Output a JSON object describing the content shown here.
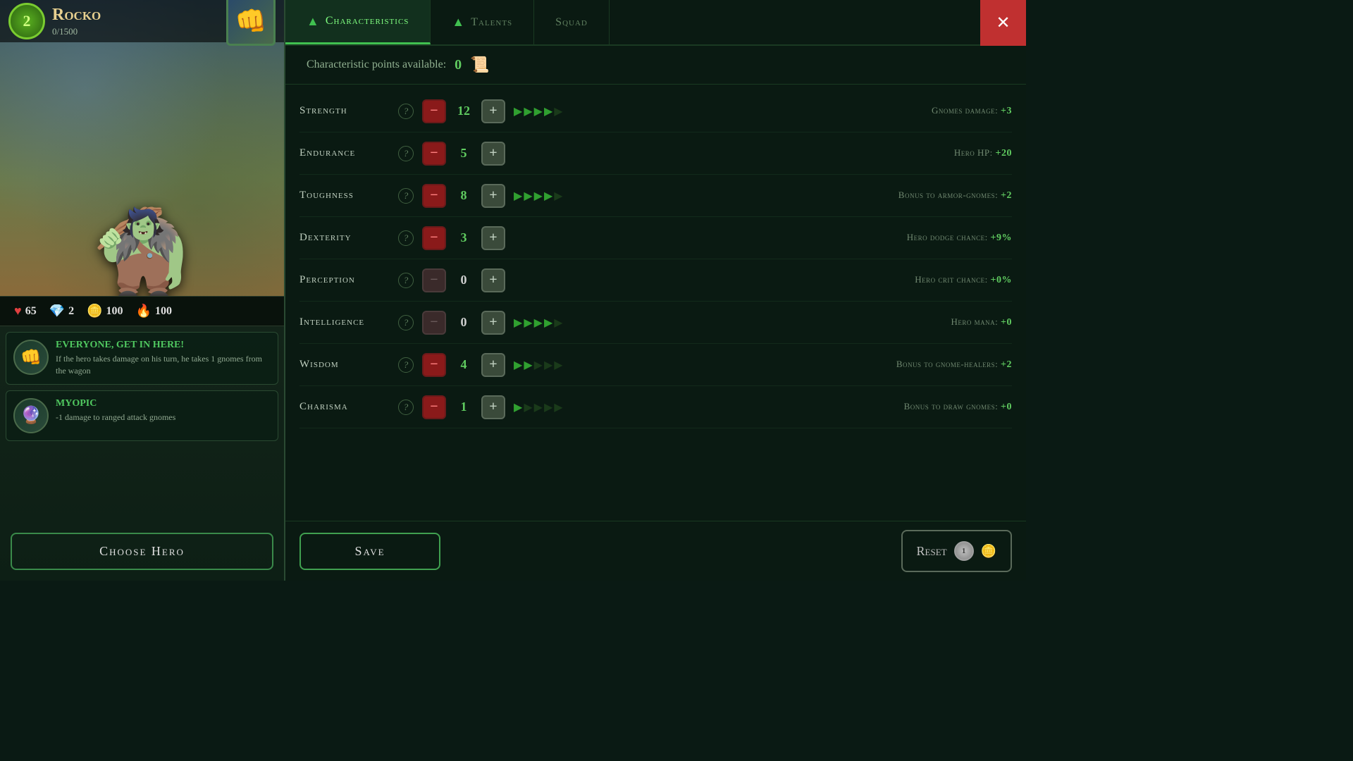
{
  "hero": {
    "name": "Rocko",
    "level": 2,
    "hp_current": 0,
    "hp_max": 1500,
    "stats": {
      "health": 65,
      "gems": 2,
      "gold": 100,
      "fire": 100
    },
    "avatar_emoji": "👊"
  },
  "traits": [
    {
      "name": "Everyone, get in here!",
      "description": "If the hero takes damage on his turn, he takes 1 gnomes from the wagon",
      "icon": "👊"
    },
    {
      "name": "Myopic",
      "description": "-1 damage to ranged attack gnomes",
      "icon": "🧙"
    }
  ],
  "choose_hero_label": "Choose Hero",
  "tabs": [
    {
      "label": "Characteristics",
      "active": true
    },
    {
      "label": "Talents",
      "active": false
    },
    {
      "label": "Squad",
      "active": false
    }
  ],
  "close_label": "✕",
  "char_points_label": "Characteristic points available:",
  "char_points_value": "0",
  "characteristics": [
    {
      "name": "Strength",
      "value": 12,
      "value_color": "green",
      "arrows": 4,
      "effect_label": "Gnomes damage:",
      "effect_value": "+3",
      "minus_enabled": true
    },
    {
      "name": "Endurance",
      "value": 5,
      "value_color": "green",
      "arrows": 0,
      "effect_label": "Hero HP:",
      "effect_value": "+20",
      "minus_enabled": true
    },
    {
      "name": "Toughness",
      "value": 8,
      "value_color": "green",
      "arrows": 4,
      "effect_label": "Bonus to armor-gnomes:",
      "effect_value": "+2",
      "minus_enabled": true
    },
    {
      "name": "Dexterity",
      "value": 3,
      "value_color": "green",
      "arrows": 0,
      "effect_label": "Hero dodge chance:",
      "effect_value": "+9%",
      "minus_enabled": true
    },
    {
      "name": "Perception",
      "value": 0,
      "value_color": "white",
      "arrows": 0,
      "effect_label": "Hero crit chance:",
      "effect_value": "+0%",
      "minus_enabled": false
    },
    {
      "name": "Intelligence",
      "value": 0,
      "value_color": "white",
      "arrows": 4,
      "effect_label": "Hero mana:",
      "effect_value": "+0",
      "minus_enabled": false
    },
    {
      "name": "Wisdom",
      "value": 4,
      "value_color": "green",
      "arrows": 2,
      "effect_label": "Bonus to gnome-healers:",
      "effect_value": "+2",
      "minus_enabled": true
    },
    {
      "name": "Charisma",
      "value": 1,
      "value_color": "green",
      "arrows": 1,
      "effect_label": "Bonus to draw gnomes:",
      "effect_value": "+0",
      "minus_enabled": true
    }
  ],
  "save_label": "Save",
  "reset_label": "Reset",
  "reset_count": "1"
}
